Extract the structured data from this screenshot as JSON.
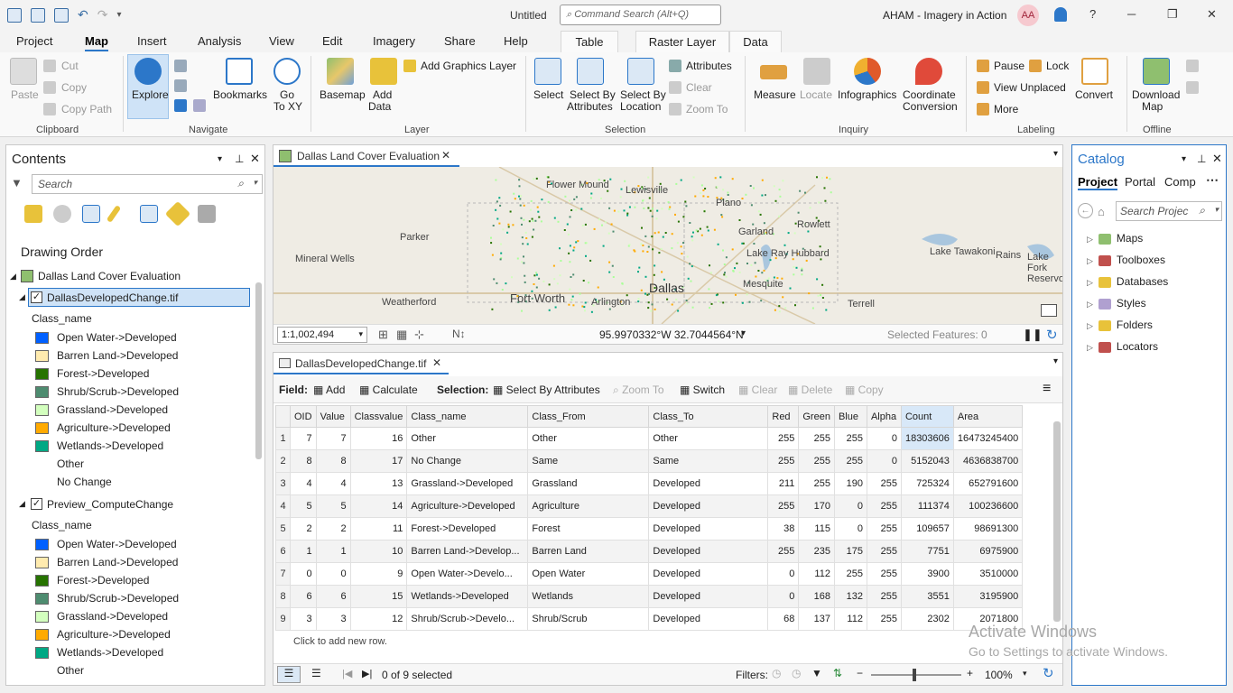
{
  "titlebar": {
    "doc_title": "Untitled",
    "command_search_placeholder": "Command Search (Alt+Q)",
    "project_name": "AHAM - Imagery in Action",
    "user_initials": "AA",
    "help_label": "?",
    "minimize_glyph": "─",
    "maximize_glyph": "❐",
    "close_glyph": "✕"
  },
  "tabs": [
    "Project",
    "Map",
    "Insert",
    "Analysis",
    "View",
    "Edit",
    "Imagery",
    "Share",
    "Help"
  ],
  "context_tabs": [
    "Table",
    "Raster Layer",
    "Data"
  ],
  "ribbon": {
    "clipboard": {
      "paste": "Paste",
      "cut": "Cut",
      "copy": "Copy",
      "copy_path": "Copy Path",
      "group": "Clipboard"
    },
    "navigate": {
      "explore": "Explore",
      "bookmarks": "Bookmarks",
      "go_to_xy_1": "Go",
      "go_to_xy_2": "To XY",
      "group": "Navigate"
    },
    "layer": {
      "basemap": "Basemap",
      "add_data_1": "Add",
      "add_data_2": "Data",
      "add_graphics_layer": "Add Graphics Layer",
      "group": "Layer"
    },
    "selection": {
      "select": "Select",
      "sba_1": "Select By",
      "sba_2": "Attributes",
      "sbl_1": "Select By",
      "sbl_2": "Location",
      "attributes": "Attributes",
      "clear": "Clear",
      "zoom_to": "Zoom To",
      "group": "Selection"
    },
    "inquiry": {
      "measure": "Measure",
      "locate": "Locate",
      "infographics": "Infographics",
      "coord_1": "Coordinate",
      "coord_2": "Conversion",
      "group": "Inquiry"
    },
    "labeling": {
      "pause": "Pause",
      "lock": "Lock",
      "view_unplaced": "View Unplaced",
      "more": "More",
      "convert": "Convert",
      "group": "Labeling"
    },
    "offline": {
      "download_1": "Download",
      "download_2": "Map",
      "group": "Offline"
    }
  },
  "contents": {
    "title": "Contents",
    "search_placeholder": "Search",
    "drawing_order": "Drawing Order",
    "map_name": "Dallas Land Cover Evaluation",
    "layer1": {
      "name": "DallasDevelopedChange.tif",
      "field": "Class_name",
      "classes": [
        {
          "label": "Open Water->Developed",
          "color": "#0060ff"
        },
        {
          "label": "Barren Land->Developed",
          "color": "#ffebaf"
        },
        {
          "label": "Forest->Developed",
          "color": "#267300"
        },
        {
          "label": "Shrub/Scrub->Developed",
          "color": "#4e8c70"
        },
        {
          "label": "Grassland->Developed",
          "color": "#d3ffbe"
        },
        {
          "label": "Agriculture->Developed",
          "color": "#ffaa00"
        },
        {
          "label": "Wetlands->Developed",
          "color": "#00a884"
        },
        {
          "label": "Other",
          "color": ""
        },
        {
          "label": "No Change",
          "color": ""
        }
      ]
    },
    "layer2": {
      "name": "Preview_ComputeChange",
      "field": "Class_name",
      "classes": [
        {
          "label": "Open Water->Developed",
          "color": "#0060ff"
        },
        {
          "label": "Barren Land->Developed",
          "color": "#ffebaf"
        },
        {
          "label": "Forest->Developed",
          "color": "#267300"
        },
        {
          "label": "Shrub/Scrub->Developed",
          "color": "#4e8c70"
        },
        {
          "label": "Grassland->Developed",
          "color": "#d3ffbe"
        },
        {
          "label": "Agriculture->Developed",
          "color": "#ffaa00"
        },
        {
          "label": "Wetlands->Developed",
          "color": "#00a884"
        },
        {
          "label": "Other",
          "color": ""
        }
      ]
    }
  },
  "map": {
    "tab_title": "Dallas Land Cover Evaluation",
    "places": [
      "Flower Mound",
      "Lewisville",
      "Plano",
      "Parker",
      "Rowlett",
      "Garland",
      "Lake Ray Hubbard",
      "Lake Tawakoni",
      "Rains",
      "Lake Fork Reservoir",
      "Mineral Wells",
      "Weatherford",
      "Fort Worth",
      "Arlington",
      "Dallas",
      "Mesquite",
      "Terrell"
    ],
    "scale": "1:1,002,494",
    "coordinates": "95.9970332°W 32.7044564°N",
    "selected_features": "Selected Features: 0"
  },
  "table": {
    "tab_title": "DallasDevelopedChange.tif",
    "toolbar": {
      "field": "Field:",
      "add": "Add",
      "calculate": "Calculate",
      "selection": "Selection:",
      "select_by_attributes": "Select By Attributes",
      "zoom_to": "Zoom To",
      "switch": "Switch",
      "clear": "Clear",
      "delete": "Delete",
      "copy": "Copy"
    },
    "columns": [
      "OID",
      "Value",
      "Classvalue",
      "Class_name",
      "Class_From",
      "Class_To",
      "Red",
      "Green",
      "Blue",
      "Alpha",
      "Count",
      "Area"
    ],
    "rows": [
      [
        "1",
        "7",
        "7",
        "16",
        "Other",
        "Other",
        "Other",
        "255",
        "255",
        "255",
        "0",
        "18303606",
        "16473245400"
      ],
      [
        "2",
        "8",
        "8",
        "17",
        "No Change",
        "Same",
        "Same",
        "255",
        "255",
        "255",
        "0",
        "5152043",
        "4636838700"
      ],
      [
        "3",
        "4",
        "4",
        "13",
        "Grassland->Developed",
        "Grassland",
        "Developed",
        "211",
        "255",
        "190",
        "255",
        "725324",
        "652791600"
      ],
      [
        "4",
        "5",
        "5",
        "14",
        "Agriculture->Developed",
        "Agriculture",
        "Developed",
        "255",
        "170",
        "0",
        "255",
        "111374",
        "100236600"
      ],
      [
        "5",
        "2",
        "2",
        "11",
        "Forest->Developed",
        "Forest",
        "Developed",
        "38",
        "115",
        "0",
        "255",
        "109657",
        "98691300"
      ],
      [
        "6",
        "1",
        "1",
        "10",
        "Barren Land->Develop...",
        "Barren Land",
        "Developed",
        "255",
        "235",
        "175",
        "255",
        "7751",
        "6975900"
      ],
      [
        "7",
        "0",
        "0",
        "9",
        "Open Water->Develo...",
        "Open Water",
        "Developed",
        "0",
        "112",
        "255",
        "255",
        "3900",
        "3510000"
      ],
      [
        "8",
        "6",
        "6",
        "15",
        "Wetlands->Developed",
        "Wetlands",
        "Developed",
        "0",
        "168",
        "132",
        "255",
        "3551",
        "3195900"
      ],
      [
        "9",
        "3",
        "3",
        "12",
        "Shrub/Scrub->Develo...",
        "Shrub/Scrub",
        "Developed",
        "68",
        "137",
        "112",
        "255",
        "2302",
        "2071800"
      ]
    ],
    "add_row_hint": "Click to add new row.",
    "selected_status": "0 of 9 selected",
    "filters_label": "Filters:",
    "zoom": "100%"
  },
  "catalog": {
    "title": "Catalog",
    "tabs": [
      "Project",
      "Portal",
      "Comp"
    ],
    "search_placeholder": "Search Projec",
    "items": [
      "Maps",
      "Toolboxes",
      "Databases",
      "Styles",
      "Folders",
      "Locators"
    ]
  },
  "watermark": {
    "line1": "Activate Windows",
    "line2": "Go to Settings to activate Windows."
  }
}
